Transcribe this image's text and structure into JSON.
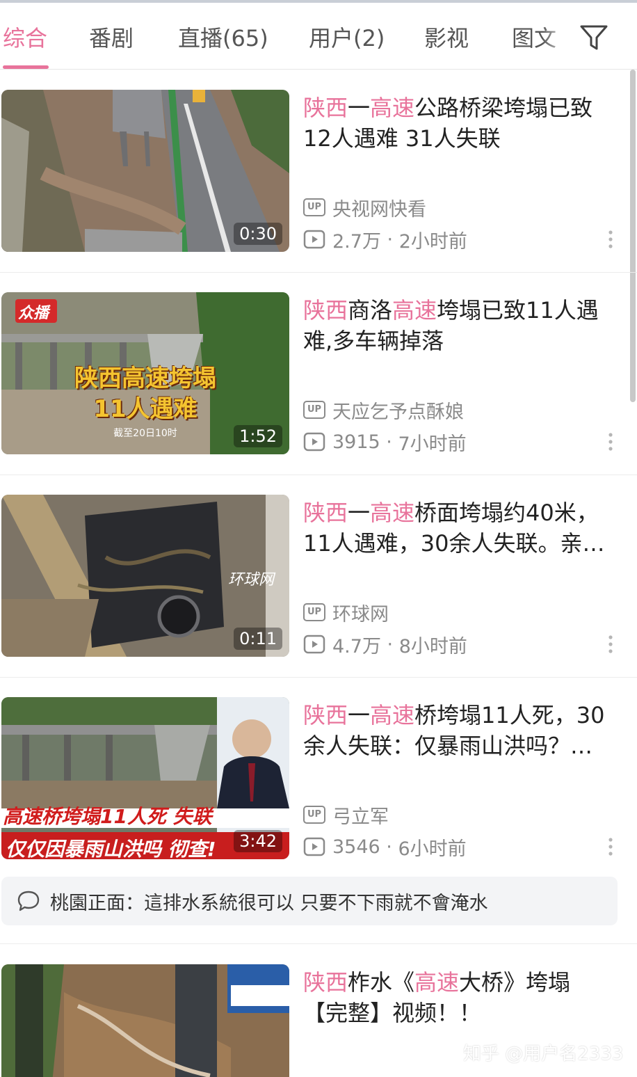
{
  "tabs": [
    {
      "label": "综合",
      "active": true
    },
    {
      "label": "番剧"
    },
    {
      "label": "直播(65)"
    },
    {
      "label": "用户(2)"
    },
    {
      "label": "影视"
    },
    {
      "label": "图文"
    }
  ],
  "icons": {
    "filter": "filter-icon",
    "up": "up-badge-icon",
    "play": "play-count-icon",
    "more": "more-vertical-icon",
    "comment": "comment-bubble-icon"
  },
  "colors": {
    "accent": "#e8739b",
    "meta": "#8a8a8a"
  },
  "up_badge": "UP",
  "videos": [
    {
      "title_parts": [
        {
          "text": "陕西",
          "hl": true
        },
        {
          "text": "一",
          "hl": false
        },
        {
          "text": "高速",
          "hl": true
        },
        {
          "text": "公路桥梁垮塌已致12人遇难 31人失联",
          "hl": false
        }
      ],
      "author": "央视网快看",
      "views": "2.7万",
      "time": "2小时前",
      "duration": "0:30"
    },
    {
      "title_parts": [
        {
          "text": "陕西",
          "hl": true
        },
        {
          "text": "商洛",
          "hl": false
        },
        {
          "text": "高速",
          "hl": true
        },
        {
          "text": "垮塌已致11人遇难,多车辆掉落",
          "hl": false
        }
      ],
      "author": "天应乞予点酥娘",
      "views": "3915",
      "time": "7小时前",
      "duration": "1:52",
      "overlay": {
        "logo": "众播",
        "line1": "陕西高速垮塌",
        "line2": "11人遇难",
        "sub": "截至20日10时"
      }
    },
    {
      "title_parts": [
        {
          "text": "陕西",
          "hl": true
        },
        {
          "text": "一",
          "hl": false
        },
        {
          "text": "高速",
          "hl": true
        },
        {
          "text": "桥面垮塌约40米，11人遇难，30余人失联。亲…",
          "hl": false
        }
      ],
      "author": "环球网",
      "views": "4.7万",
      "time": "8小时前",
      "duration": "0:11",
      "overlay": {
        "watermark": "环球网"
      }
    },
    {
      "title_parts": [
        {
          "text": "陕西",
          "hl": true
        },
        {
          "text": "一",
          "hl": false
        },
        {
          "text": "高速",
          "hl": true
        },
        {
          "text": "桥垮塌11人死，30余人失联：仅暴雨山洪吗？…",
          "hl": false
        }
      ],
      "author": "弓立军",
      "views": "3546",
      "time": "6小时前",
      "duration": "3:42",
      "overlay": {
        "line1": "高速桥垮塌11人死 失联",
        "line2": "仅仅因暴雨山洪吗 彻查!"
      }
    },
    {
      "title_parts": [
        {
          "text": "陕西",
          "hl": true
        },
        {
          "text": "柞水《",
          "hl": false
        },
        {
          "text": "高速",
          "hl": true
        },
        {
          "text": "大桥》垮塌【完整】视频！！",
          "hl": false
        }
      ]
    }
  ],
  "comment": {
    "text": "桃園正面：這排水系統很可以 只要不下雨就不會淹水"
  },
  "watermark": "知乎 @用户名2333"
}
